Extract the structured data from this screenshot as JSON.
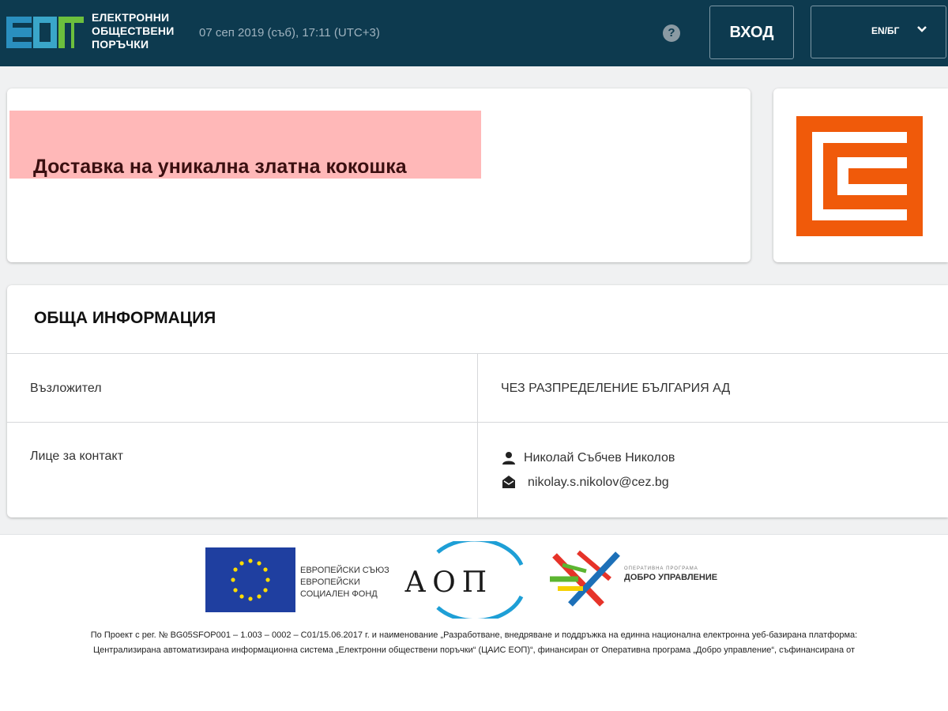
{
  "header": {
    "logo": {
      "mark": "ЕОП",
      "line1": "ЕЛЕКТРОННИ",
      "line2": "ОБЩЕСТВЕНИ",
      "line3": "ПОРЪЧКИ"
    },
    "datetime": "07 сеп 2019 (съб), 17:11 (UTC+3)",
    "help_icon": "?",
    "login_label": "ВХОД",
    "language_label": "EN/БГ"
  },
  "title_card": {
    "title": "Доставка на уникална златна кокошка"
  },
  "general_info": {
    "heading": "ОБЩА ИНФОРМАЦИЯ",
    "rows": [
      {
        "label": "Възложител",
        "value": "ЧЕЗ РАЗПРЕДЕЛЕНИЕ БЪЛГАРИЯ АД"
      },
      {
        "label": "Лице за контакт",
        "contact_name": "Николай Събчев Николов",
        "contact_email": "nikolay.s.nikolov@cez.bg"
      }
    ]
  },
  "footer": {
    "eu": {
      "line1": "ЕВРОПЕЙСКИ СЪЮЗ",
      "line2": "ЕВРОПЕЙСКИ",
      "line3": "СОЦИАЛЕН ФОНД"
    },
    "aop": "АОП",
    "dobro": {
      "small": "ОПЕРАТИВНА ПРОГРАМА",
      "big": "ДОБРО УПРАВЛЕНИЕ"
    },
    "note_line1": "По Проект с рег. № BG05SFOP001 – 1.003 – 0002 – C01/15.06.2017 г. и наименование „Разработване, внедряване и поддръжка на единна национална електронна уеб-базирана платформа:",
    "note_line2": "Централизирана автоматизирана информационна система „Електронни обществени поръчки“ (ЦАИС ЕОП)“, финансиран от Оперативна програма „Добро управление“, съфинансирана от"
  },
  "colors": {
    "header_bg": "#0d3a4f",
    "title_highlight": "#ffb8b8",
    "cez_orange": "#f05a0a",
    "eu_blue": "#1f3fa0",
    "logo_blue": "#2a8fbf",
    "logo_green": "#6cbf3d"
  }
}
